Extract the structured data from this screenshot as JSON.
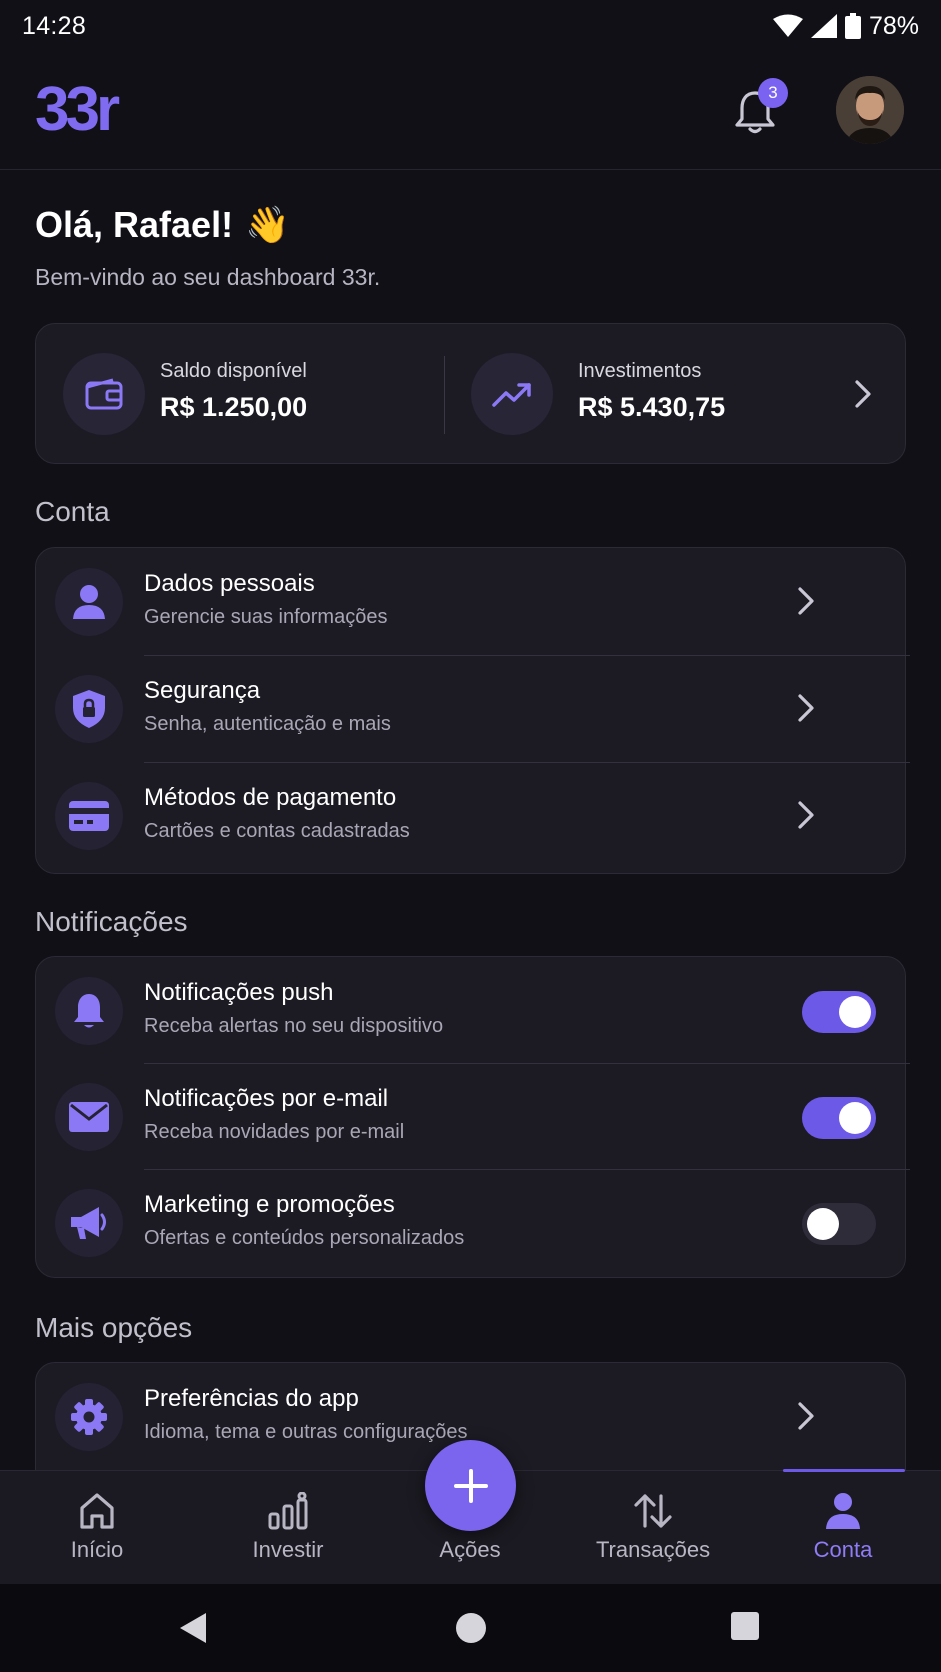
{
  "status_bar": {
    "time": "14:28",
    "battery": "78%",
    "icons": [
      "wifi-icon",
      "signal-icon",
      "battery-icon"
    ]
  },
  "header": {
    "logo": "33r",
    "notification_count": "3",
    "icons": [
      "bell-icon",
      "avatar"
    ]
  },
  "greeting": {
    "title": "Olá, Rafael!",
    "emoji": "👋",
    "subtitle": "Bem-vindo ao seu dashboard 33r."
  },
  "balances": {
    "available_label": "Saldo disponível",
    "available_value": "R$ 1.250,00",
    "investments_label": "Investimentos",
    "investments_value": "R$ 5.430,75"
  },
  "sections": {
    "account": {
      "title": "Conta",
      "items": [
        {
          "title": "Dados pessoais",
          "subtitle": "Gerencie suas informações",
          "icon": "person-icon"
        },
        {
          "title": "Segurança",
          "subtitle": "Senha, autenticação e mais",
          "icon": "shield-lock-icon"
        },
        {
          "title": "Métodos de pagamento",
          "subtitle": "Cartões e contas cadastradas",
          "icon": "credit-card-icon"
        }
      ]
    },
    "notifications": {
      "title": "Notificações",
      "items": [
        {
          "title": "Notificações push",
          "subtitle": "Receba alertas no seu dispositivo",
          "icon": "bell-icon",
          "enabled": true
        },
        {
          "title": "Notificações por e-mail",
          "subtitle": "Receba novidades por e-mail",
          "icon": "mail-icon",
          "enabled": true
        },
        {
          "title": "Marketing e promoções",
          "subtitle": "Ofertas e conteúdos personalizados",
          "icon": "megaphone-icon",
          "enabled": false
        }
      ]
    },
    "more": {
      "title": "Mais opções",
      "items": [
        {
          "title": "Preferências do app",
          "subtitle": "Idioma, tema e outras configurações",
          "icon": "gear-icon"
        }
      ]
    }
  },
  "bottom_nav": {
    "items": [
      {
        "label": "Início",
        "icon": "home-icon"
      },
      {
        "label": "Investir",
        "icon": "bar-chart-icon"
      },
      {
        "label": "Ações",
        "icon": "plus-icon"
      },
      {
        "label": "Transações",
        "icon": "transfer-arrows-icon"
      },
      {
        "label": "Conta",
        "icon": "person-icon",
        "active": true
      }
    ]
  },
  "colors": {
    "background": "#111016",
    "card": "#1c1b24",
    "accent": "#7a63f1",
    "icon_accent": "#8b78f5",
    "muted_text": "#a9a7b4"
  }
}
